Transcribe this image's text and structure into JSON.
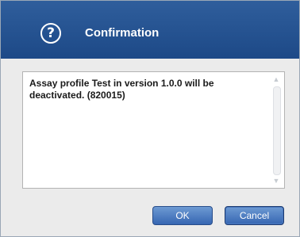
{
  "dialog": {
    "title": "Confirmation",
    "icon": "help-circle-icon",
    "message": "Assay profile Test in version 1.0.0 will be deactivated. (820015)",
    "buttons": {
      "ok_label": "OK",
      "cancel_label": "Cancel"
    },
    "colors": {
      "titlebar": "#2a5896",
      "button": "#4a7bc4",
      "background": "#ebebeb"
    }
  }
}
